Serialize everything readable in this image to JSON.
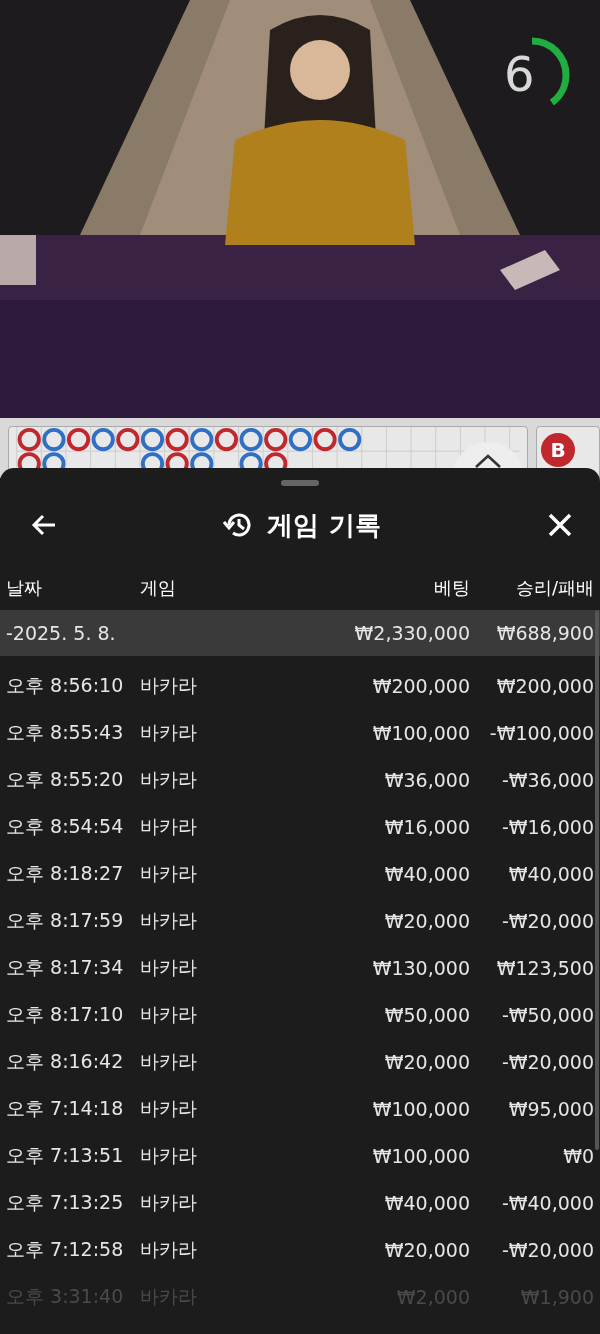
{
  "video": {
    "kind": "picture",
    "countdown": {
      "value": "6",
      "level": 0.4
    }
  },
  "road": {
    "columns": [
      {
        "beads": [
          {
            "color": "#c0282d"
          },
          {
            "color": "#c0282d"
          }
        ]
      },
      {
        "beads": [
          {
            "color": "#2f6fc4"
          },
          {
            "color": "#2f6fc4"
          }
        ]
      },
      {
        "beads": [
          {
            "color": "#c0282d"
          }
        ]
      },
      {
        "beads": [
          {
            "color": "#2f6fc4"
          }
        ]
      },
      {
        "beads": [
          {
            "color": "#c0282d"
          }
        ]
      },
      {
        "beads": [
          {
            "color": "#2f6fc4"
          },
          {
            "color": "#2f6fc4"
          }
        ]
      },
      {
        "beads": [
          {
            "color": "#c0282d"
          },
          {
            "color": "#c0282d"
          }
        ]
      },
      {
        "beads": [
          {
            "color": "#2f6fc4"
          },
          {
            "color": "#2f6fc4"
          }
        ]
      },
      {
        "beads": [
          {
            "color": "#c0282d"
          }
        ]
      },
      {
        "beads": [
          {
            "color": "#2f6fc4"
          },
          {
            "color": "#2f6fc4"
          }
        ]
      },
      {
        "beads": [
          {
            "color": "#c0282d"
          },
          {
            "color": "#c0282d"
          }
        ]
      },
      {
        "beads": [
          {
            "color": "#2f6fc4"
          }
        ]
      },
      {
        "beads": [
          {
            "color": "#c0282d"
          }
        ]
      },
      {
        "beads": [
          {
            "color": "#2f6fc4"
          }
        ]
      }
    ],
    "banker_button": "B"
  },
  "sheet": {
    "title": "게임 기록",
    "columns": [
      "날짜",
      "게임",
      "베팅",
      "승리/패배"
    ],
    "group": {
      "date": "-2025. 5. 8.",
      "bet": "₩2,330,000",
      "result": "₩688,900"
    },
    "rows": [
      {
        "time": "오후 8:56:10",
        "game": "바카라",
        "bet": "₩200,000",
        "result": "₩200,000",
        "faded": false
      },
      {
        "time": "오후 8:55:43",
        "game": "바카라",
        "bet": "₩100,000",
        "result": "-₩100,000",
        "faded": false
      },
      {
        "time": "오후 8:55:20",
        "game": "바카라",
        "bet": "₩36,000",
        "result": "-₩36,000",
        "faded": false
      },
      {
        "time": "오후 8:54:54",
        "game": "바카라",
        "bet": "₩16,000",
        "result": "-₩16,000",
        "faded": false
      },
      {
        "time": "오후 8:18:27",
        "game": "바카라",
        "bet": "₩40,000",
        "result": "₩40,000",
        "faded": false
      },
      {
        "time": "오후 8:17:59",
        "game": "바카라",
        "bet": "₩20,000",
        "result": "-₩20,000",
        "faded": false
      },
      {
        "time": "오후 8:17:34",
        "game": "바카라",
        "bet": "₩130,000",
        "result": "₩123,500",
        "faded": false
      },
      {
        "time": "오후 8:17:10",
        "game": "바카라",
        "bet": "₩50,000",
        "result": "-₩50,000",
        "faded": false
      },
      {
        "time": "오후 8:16:42",
        "game": "바카라",
        "bet": "₩20,000",
        "result": "-₩20,000",
        "faded": false
      },
      {
        "time": "오후 7:14:18",
        "game": "바카라",
        "bet": "₩100,000",
        "result": "₩95,000",
        "faded": false
      },
      {
        "time": "오후 7:13:51",
        "game": "바카라",
        "bet": "₩100,000",
        "result": "₩0",
        "faded": false
      },
      {
        "time": "오후 7:13:25",
        "game": "바카라",
        "bet": "₩40,000",
        "result": "-₩40,000",
        "faded": false
      },
      {
        "time": "오후 7:12:58",
        "game": "바카라",
        "bet": "₩20,000",
        "result": "-₩20,000",
        "faded": false
      },
      {
        "time": "오후 3:31:40",
        "game": "바카라",
        "bet": "₩2,000",
        "result": "₩1,900",
        "faded": true
      }
    ]
  }
}
